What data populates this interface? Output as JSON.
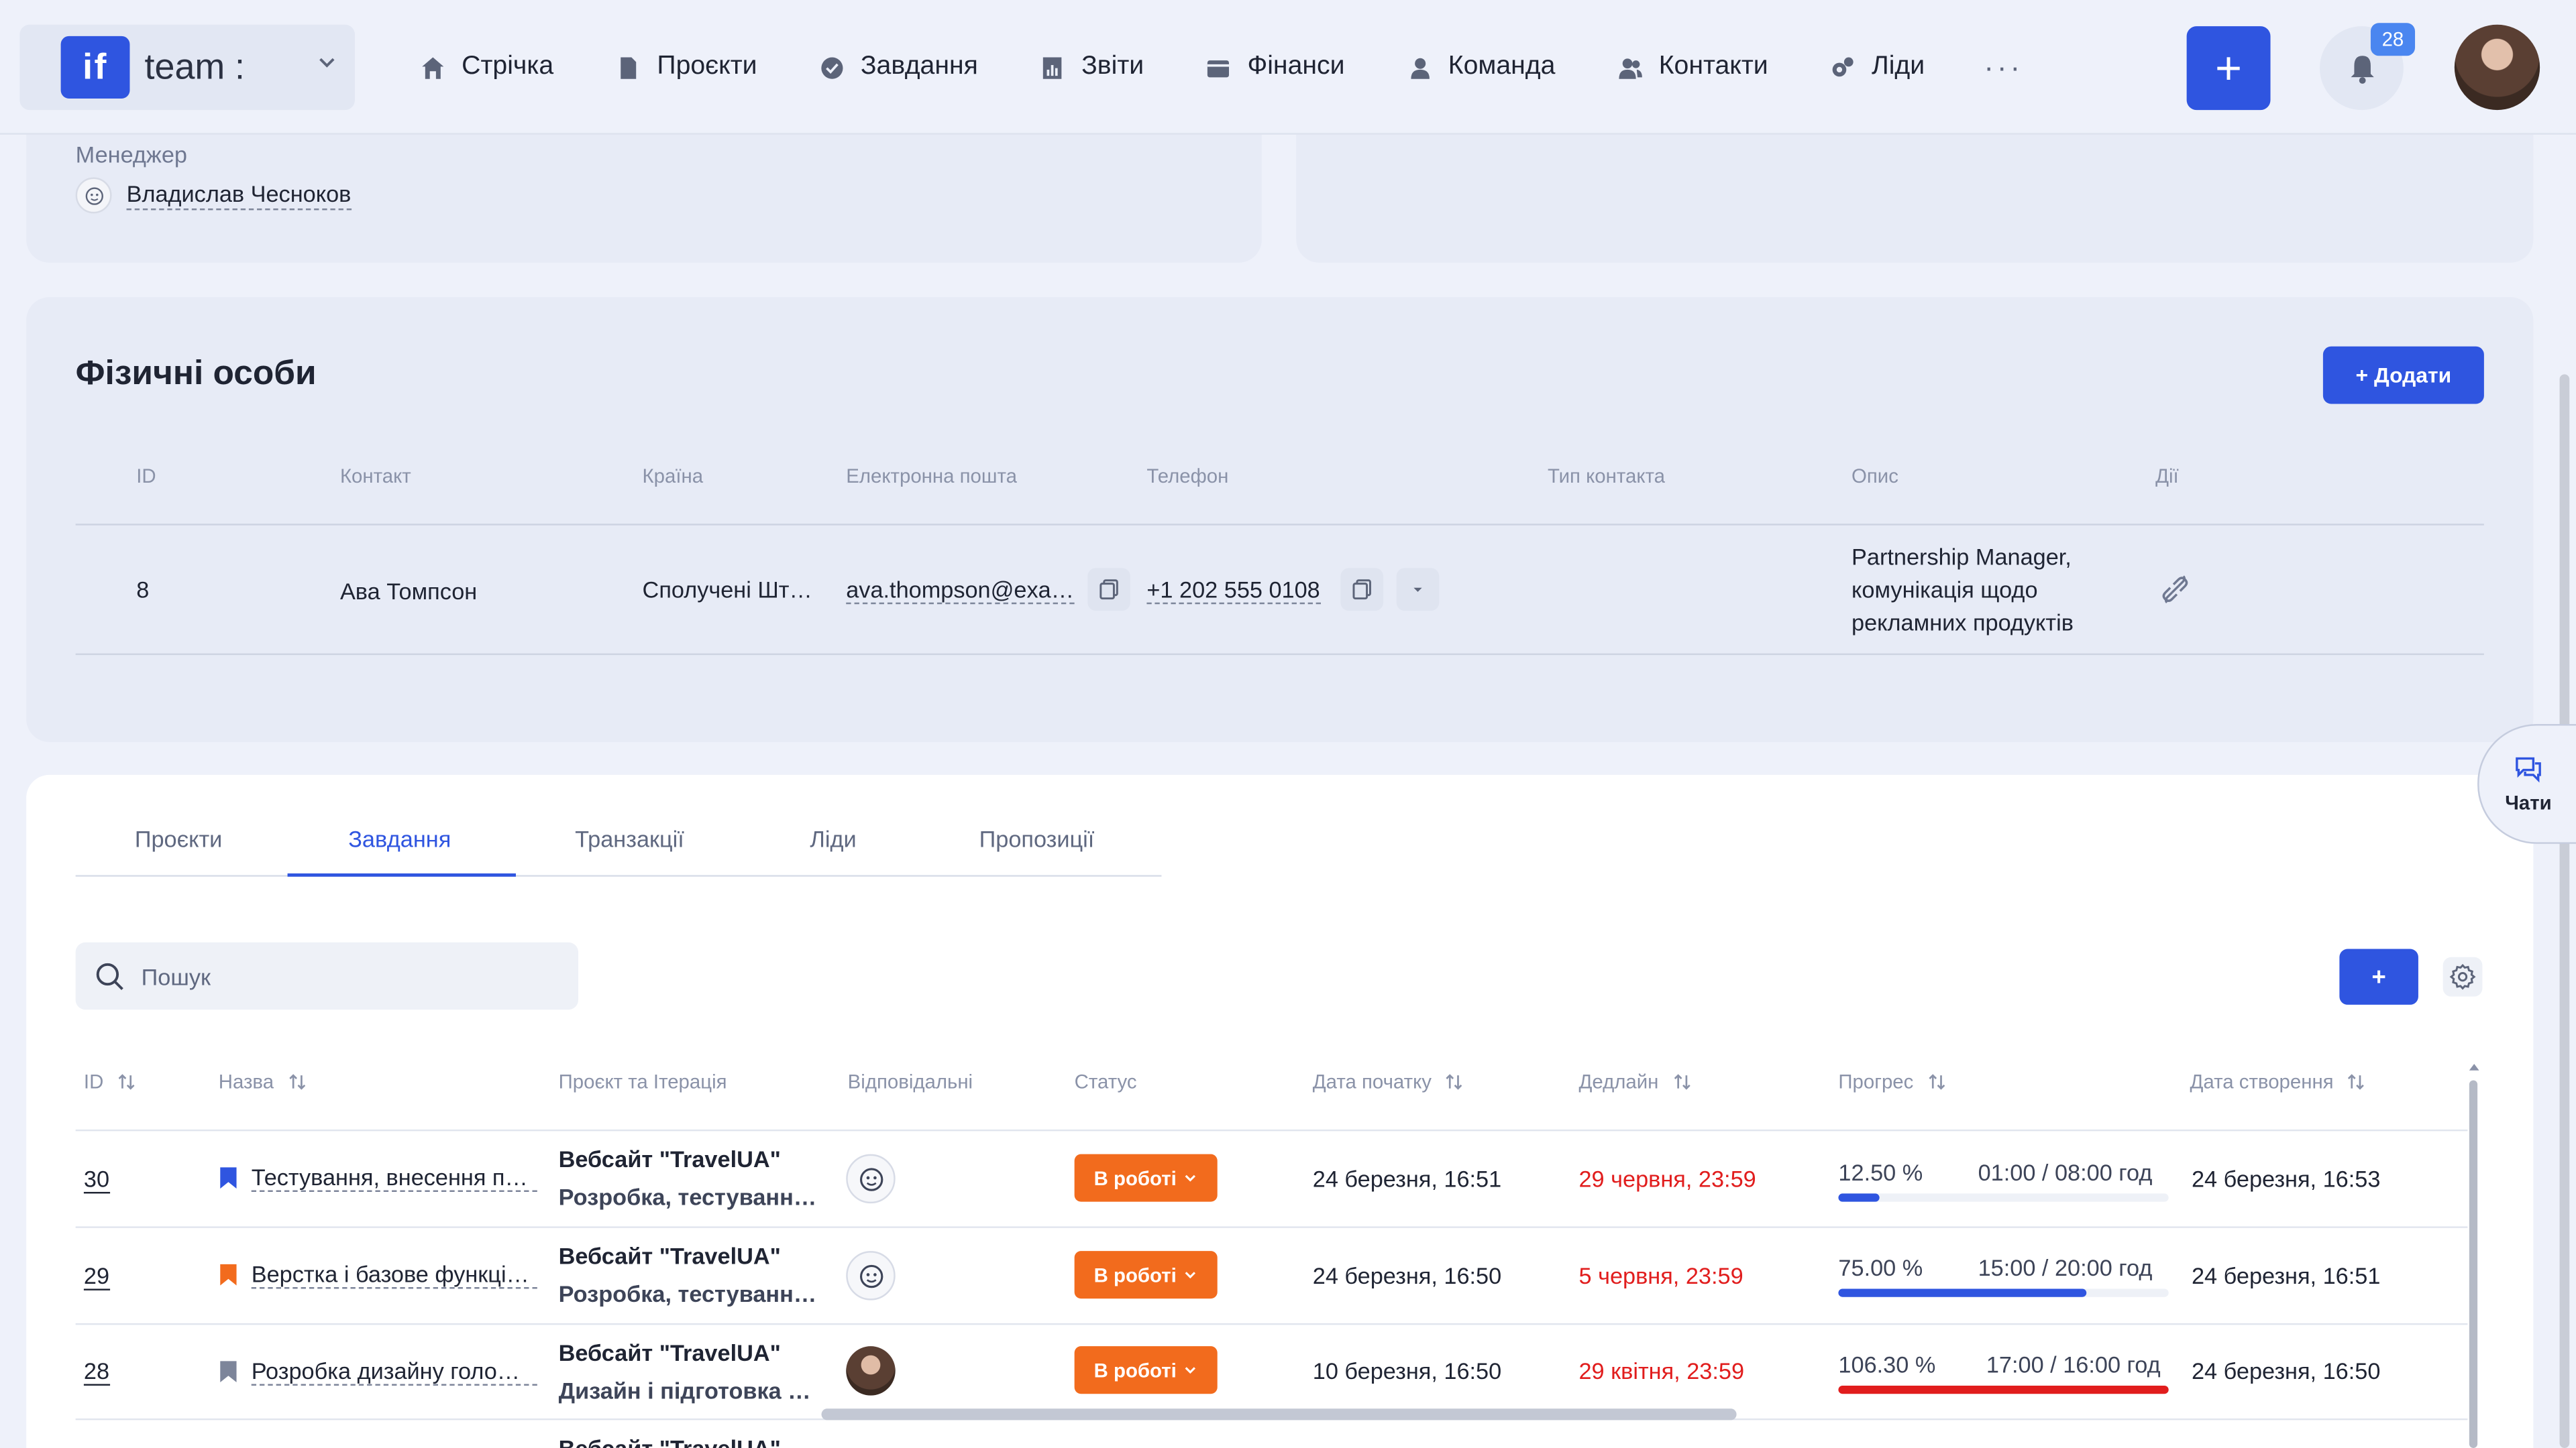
{
  "brand": {
    "logo_text": "if",
    "name": "team",
    "dots": ":"
  },
  "nav": {
    "items": [
      {
        "label": "Стрічка",
        "icon": "home-icon"
      },
      {
        "label": "Проєкти",
        "icon": "document-icon"
      },
      {
        "label": "Завдання",
        "icon": "check-circle-icon"
      },
      {
        "label": "Звіти",
        "icon": "report-icon"
      },
      {
        "label": "Фінанси",
        "icon": "wallet-icon"
      },
      {
        "label": "Команда",
        "icon": "user-icon"
      },
      {
        "label": "Контакти",
        "icon": "contacts-icon"
      },
      {
        "label": "Ліди",
        "icon": "leads-icon"
      }
    ],
    "more": "···",
    "add": "+",
    "notifications_count": "28"
  },
  "manager": {
    "label": "Менеджер",
    "name": "Владислав Чесноков"
  },
  "individuals": {
    "title": "Фізичні особи",
    "add_label": "+ Додати",
    "columns": [
      "ID",
      "Контакт",
      "Країна",
      "Електронна пошта",
      "Телефон",
      "Тип контакта",
      "Опис",
      "Дії"
    ],
    "row": {
      "id": "8",
      "contact": "Ава Томпсон",
      "country": "Сполучені Шт…",
      "email": "ava.thompson@exa…",
      "phone": "+1 202 555 0108",
      "contact_type": "",
      "description_lines": [
        "Partnership Manager,",
        "комунікація щодо",
        "рекламних продуктів"
      ]
    }
  },
  "tabs": [
    "Проєкти",
    "Завдання",
    "Транзакції",
    "Ліди",
    "Пропозиції"
  ],
  "active_tab": "Завдання",
  "search": {
    "placeholder": "Пошук"
  },
  "tasks_add": "+",
  "task_columns": [
    "ID",
    "Назва",
    "Проєкт та Ітерація",
    "Відповідальні",
    "Статус",
    "Дата початку",
    "Дедлайн",
    "Прогрес",
    "Дата створення"
  ],
  "tasks": [
    {
      "id": "30",
      "flag_color": "#2f55e0",
      "name": "Тестування, внесення п…",
      "project": "Вебсайт \"TravelUA\"",
      "iteration": "Розробка, тестуванн…",
      "status": "В роботі",
      "start": "24 березня, 16:51",
      "deadline": "29 червня, 23:59",
      "progress_pct": "12.50 %",
      "progress_time": "01:00 / 08:00 год",
      "progress_value": 12.5,
      "progress_color": "#2f55e0",
      "created": "24 березня, 16:53",
      "responsible": "avatar-icon"
    },
    {
      "id": "29",
      "flag_color": "#f26b1d",
      "name": "Верстка і базове функці…",
      "project": "Вебсайт \"TravelUA\"",
      "iteration": "Розробка, тестуванн…",
      "status": "В роботі",
      "start": "24 березня, 16:50",
      "deadline": "5 червня, 23:59",
      "progress_pct": "75.00 %",
      "progress_time": "15:00 / 20:00 год",
      "progress_value": 75,
      "progress_color": "#2f55e0",
      "created": "24 березня, 16:51",
      "responsible": "avatar-icon"
    },
    {
      "id": "28",
      "flag_color": "#7d859a",
      "name": "Розробка дизайну голо…",
      "project": "Вебсайт \"TravelUA\"",
      "iteration": "Дизайн і підготовка к…",
      "status": "В роботі",
      "start": "10 березня, 16:50",
      "deadline": "29 квітня, 23:59",
      "progress_pct": "106.30 %",
      "progress_time": "17:00 / 16:00 год",
      "progress_value": 100,
      "progress_color": "#e11d1d",
      "created": "24 березня, 16:50",
      "responsible": "photo"
    }
  ],
  "partial_row_project": "Вебсайт \"TravelUA\"",
  "chat": {
    "label": "Чати"
  }
}
